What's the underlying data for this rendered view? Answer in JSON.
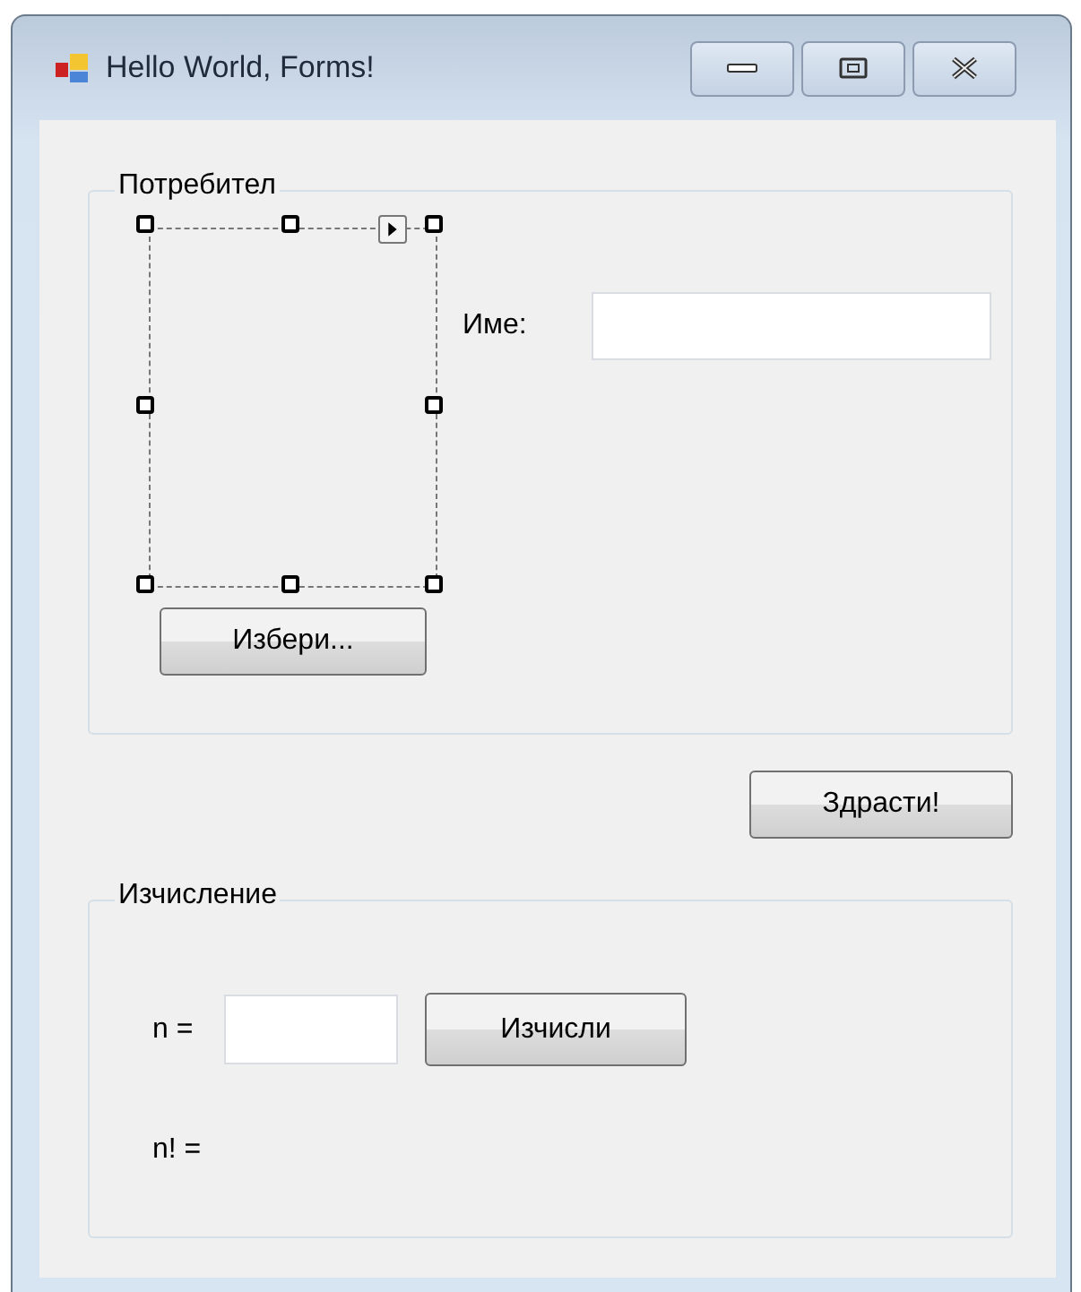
{
  "window": {
    "title": "Hello World, Forms!"
  },
  "groups": [
    {
      "legend": "Потребител",
      "picture_box": {
        "selected": true
      },
      "choose_button": "Избери...",
      "name_label": "Име:"
    },
    {
      "legend": "Изчисление",
      "n_label": "n =",
      "compute_button": "Изчисли",
      "result_label": "n! ="
    }
  ],
  "greet_button": "Здрасти!"
}
